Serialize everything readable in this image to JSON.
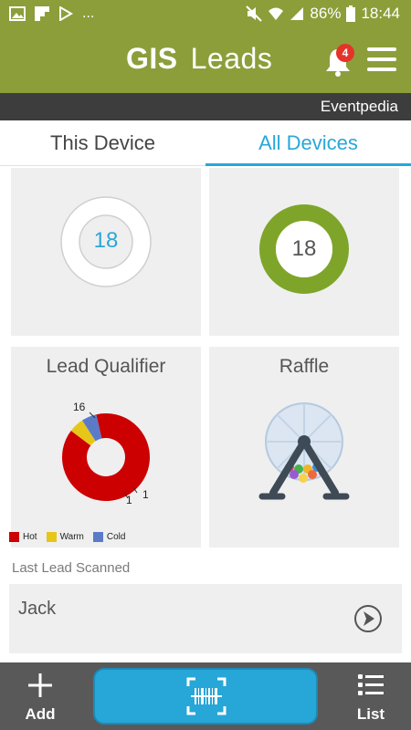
{
  "status_bar": {
    "left_icons": [
      "image-icon",
      "flipboard-icon",
      "play-store-icon"
    ],
    "more": "...",
    "battery": "86%",
    "time": "18:44"
  },
  "app_bar": {
    "title_bold": "GIS",
    "title_light": "Leads",
    "notification_count": "4"
  },
  "sub_bar": {
    "event": "Eventpedia"
  },
  "tabs": [
    {
      "label": "This Device",
      "active": false
    },
    {
      "label": "All Devices",
      "active": true
    }
  ],
  "cards": {
    "left_top": {
      "value": "18",
      "color": "#29a7d9"
    },
    "right_top": {
      "value": "18",
      "ring_color": "#7ea529"
    },
    "lead_qualifier": {
      "title": "Lead Qualifier",
      "chart_data": {
        "type": "pie",
        "categories": [
          "Hot",
          "Warm",
          "Cold"
        ],
        "values": [
          16,
          1,
          1
        ],
        "labels": [
          "16",
          "1",
          "1"
        ],
        "colors": [
          "#cc0000",
          "#e6c619",
          "#5b7bc9"
        ]
      }
    },
    "raffle": {
      "title": "Raffle"
    }
  },
  "last_lead": {
    "label": "Last Lead Scanned",
    "name": "Jack"
  },
  "bottom_bar": {
    "add_label": "Add",
    "list_label": "List"
  }
}
